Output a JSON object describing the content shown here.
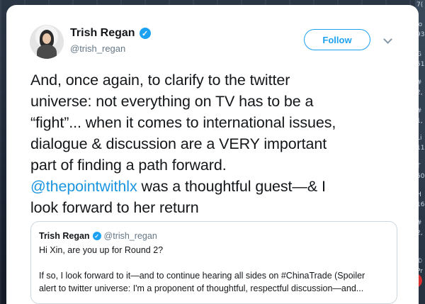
{
  "side": {
    "letters": [
      "7(",
      "Jo",
      "93",
      "G",
      "51",
      "#",
      "2,",
      "#",
      "1,",
      "Li",
      "11",
      "T",
      "50",
      "H",
      "16",
      "#",
      "2,",
      "©",
      "Pr"
    ],
    "badge": "早"
  },
  "tweet": {
    "author": {
      "name": "Trish Regan",
      "handle": "@trish_regan",
      "verified_glyph": "✓"
    },
    "follow_label": "Follow",
    "text_lines": [
      "And, once again, to clarify to the twitter",
      "universe: not everything on TV has to be a",
      "“fight”... when it comes to international issues,",
      "dialogue & discussion are a VERY important",
      "part of finding a path forward.",
      "",
      "look forward to her return"
    ],
    "mention": "@thepointwithlx",
    "mention_rest": " was a thoughtful guest—& I",
    "quoted": {
      "name": "Trish Regan",
      "handle": "@trish_regan",
      "verified_glyph": "✓",
      "line1": "Hi Xin, are you up for Round 2?",
      "line2": "If so, I look forward to it—and to continue hearing all sides on #ChinaTrade (Spoiler",
      "line3": "alert to twitter universe: I'm a proponent of thoughtful, respectful discussion—and..."
    }
  },
  "colors": {
    "accent": "#1da1f2",
    "mention": "#1b95e0",
    "text": "#14171a",
    "muted": "#657786"
  },
  "icons": [
    "verified-badge-icon",
    "chevron-down-icon"
  ]
}
